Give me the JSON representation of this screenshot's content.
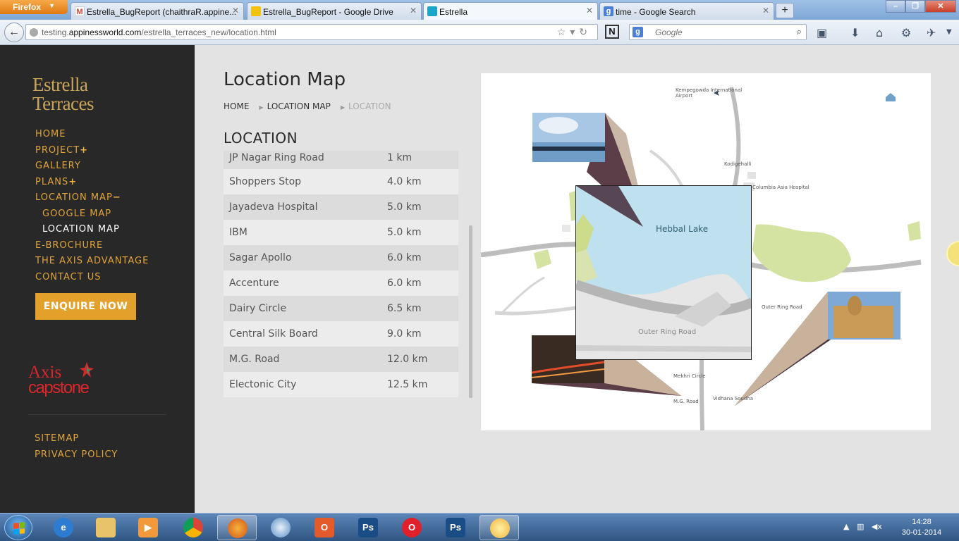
{
  "browser": {
    "app_button": "Firefox",
    "tabs": [
      {
        "title": "Estrella_BugReport (chaithraR.appine...",
        "icon": "gmail-icon"
      },
      {
        "title": "Estrella_BugReport - Google Drive",
        "icon": "google-drive-icon"
      },
      {
        "title": "Estrella",
        "icon": "site-favicon"
      },
      {
        "title": "time - Google Search",
        "icon": "google-icon"
      }
    ],
    "new_tab": "+",
    "url_prefix": "testing.",
    "url_domain": "appinessworld.com",
    "url_path": "/estrella_terraces_new/location.html",
    "search_placeholder": "Google",
    "window_controls": [
      "–",
      "❐",
      "✕"
    ]
  },
  "site": {
    "logo_line1": "Estrella",
    "logo_line2": "Terraces",
    "menu": [
      {
        "label": "HOME",
        "plus": ""
      },
      {
        "label": "PROJECT",
        "plus": "+"
      },
      {
        "label": "GALLERY",
        "plus": ""
      },
      {
        "label": "PLANS",
        "plus": "+"
      },
      {
        "label": "LOCATION MAP",
        "plus": "−"
      },
      {
        "label": "GOOGLE MAP",
        "plus": ""
      },
      {
        "label": "LOCATION MAP",
        "plus": ""
      },
      {
        "label": "E-BROCHURE",
        "plus": ""
      },
      {
        "label": "THE AXIS ADVANTAGE",
        "plus": ""
      },
      {
        "label": "CONTACT US",
        "plus": ""
      }
    ],
    "enquire_label": "ENQUIRE NOW",
    "partner_logo_line1": "Axis",
    "partner_logo_line2": "capstone",
    "footer_links": [
      "SITEMAP",
      "PRIVACY POLICY"
    ]
  },
  "main": {
    "page_title": "Location Map",
    "breadcrumb": [
      "HOME",
      "LOCATION MAP",
      "LOCATION"
    ],
    "section_title": "LOCATION",
    "distances": [
      {
        "place": "JP Nagar Ring Road",
        "km": "1 km"
      },
      {
        "place": "Shoppers Stop",
        "km": "4.0 km"
      },
      {
        "place": "Jayadeva Hospital",
        "km": "5.0 km"
      },
      {
        "place": "IBM",
        "km": "5.0 km"
      },
      {
        "place": "Sagar Apollo",
        "km": "6.0 km"
      },
      {
        "place": "Accenture",
        "km": "6.0 km"
      },
      {
        "place": "Dairy Circle",
        "km": "6.5 km"
      },
      {
        "place": "Central Silk Board",
        "km": "9.0 km"
      },
      {
        "place": "M.G. Road",
        "km": "12.0 km"
      },
      {
        "place": "Electonic City",
        "km": "12.5 km"
      }
    ],
    "map": {
      "airport_label_1": "Kempegowda International",
      "airport_label_2": "Airport",
      "lake_label": "Hebbal Lake",
      "zoom_road_label": "Outer Ring Road",
      "outer_ring_label": "Outer Ring Road",
      "labels": [
        "Kodigehalli",
        "Columbia Asia Hospital",
        "Mekhri Circle",
        "M.G. Road",
        "Vidhana Soudha"
      ]
    }
  },
  "taskbar": {
    "time": "14:28",
    "date": "30-01-2014",
    "apps": [
      "internet-explorer-icon",
      "file-explorer-icon",
      "media-player-icon",
      "chrome-icon",
      "firefox-icon",
      "safari-icon",
      "outlook-icon",
      "photoshop-icon",
      "opera-icon",
      "photoshop-icon",
      "sun-app-icon"
    ]
  }
}
